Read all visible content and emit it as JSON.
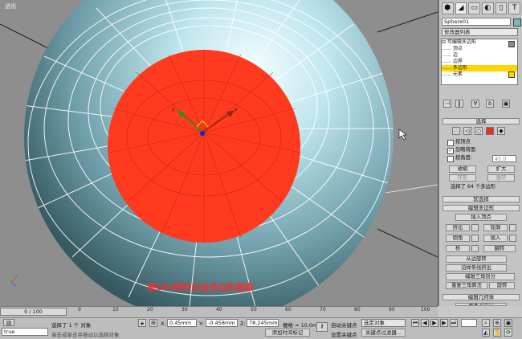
{
  "viewport": {
    "label": "透视",
    "caption": "按Ctrl同时点击多边形层级"
  },
  "panel": {
    "tabs": [
      "⬢",
      "◢",
      "▭",
      "◐",
      "▯",
      "T"
    ],
    "object_name": "Sphere01",
    "modifier_list": "修改器列表",
    "stack": [
      {
        "label": "⊟ 可编辑多边形",
        "selected": false
      },
      {
        "label": "…… 顶点",
        "selected": false
      },
      {
        "label": "…… 边",
        "selected": false
      },
      {
        "label": "…… 边界",
        "selected": false
      },
      {
        "label": "…… 多边形",
        "selected": true
      },
      {
        "label": "…… 元素",
        "selected": false
      }
    ],
    "selection": {
      "header": "选择",
      "by_vertex": "按顶点",
      "ignore_backfacing": "忽略背面",
      "by_angle": "按角度:",
      "angle_value": "45.0",
      "shrink": "收缩",
      "grow": "扩大",
      "ring": "环形",
      "loop": "循环",
      "info": "选择了 64 个多边形"
    },
    "soft_selection": "软选择",
    "edit_polygons": {
      "header": "编辑多边形",
      "insert_vertex": "插入顶点",
      "extrude": "挤出",
      "outline": "轮廓",
      "bevel": "倒角",
      "inset": "插入",
      "bridge": "桥",
      "flip": "翻转",
      "hinge": "从边旋转",
      "extrude_spline": "沿样条线挤出",
      "edit_triangulation": "编辑三角剖分",
      "retriangulate": "重复三角算法",
      "turn": "旋转"
    },
    "edit_geometry": {
      "header": "编辑几何体",
      "repeat_last": "重复上一个"
    }
  },
  "timeline": {
    "slider": "0 / 100",
    "ticks": [
      "0",
      "10",
      "20",
      "30",
      "40",
      "50",
      "60",
      "70",
      "80",
      "90",
      "100"
    ]
  },
  "statusbar": {
    "script_field": "true",
    "selected_info": "选择了 1 个 对象",
    "prompt": "单击或单击并拖动以选择对象",
    "x_label": "X:",
    "x_value": "0.45mm",
    "y_label": "Y:",
    "y_value": "-0.458mm",
    "z_label": "Z:",
    "z_value": "78.245mm",
    "grid": "栅格 = 10.0mm",
    "add_time_tag": "添加时间标记",
    "auto_key": "自动关键点",
    "selected_set": "选定对象",
    "set_key": "设置关键点",
    "key_filters": "关键点过滤器..."
  },
  "colors": {
    "viewport_bg": "#8e8e8e",
    "sphere": "#7fb3bf",
    "selection": "#ff3a1f",
    "stack_highlight": "#ffd400",
    "caption": "#ff2a2a"
  }
}
